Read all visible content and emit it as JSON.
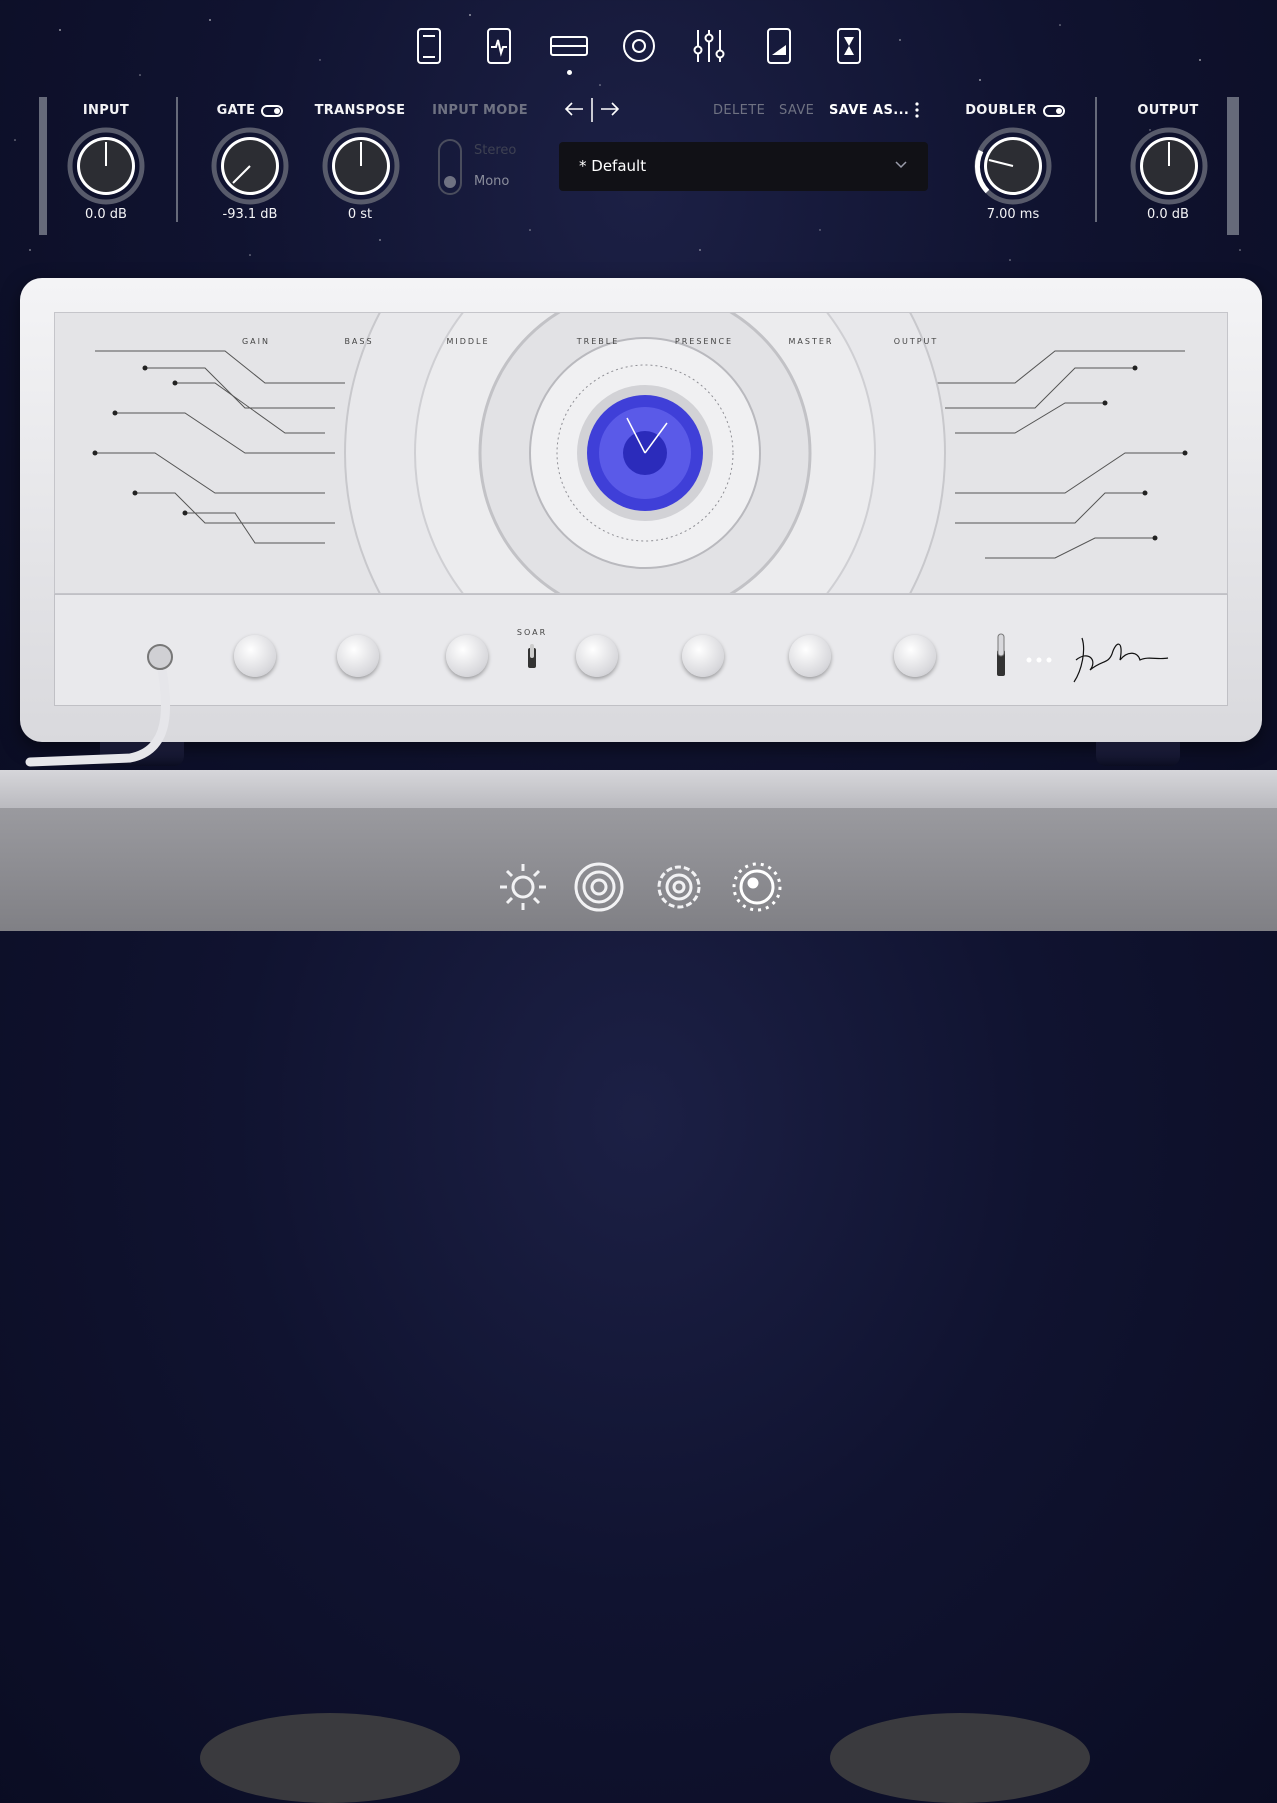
{
  "nav": {
    "items": [
      {
        "icon": "amp-head-icon",
        "active": false
      },
      {
        "icon": "pedal-icon",
        "active": false
      },
      {
        "icon": "amp-icon",
        "active": true
      },
      {
        "icon": "cabinet-icon",
        "active": false
      },
      {
        "icon": "mixer-sliders-icon",
        "active": false
      },
      {
        "icon": "volume-pedal-icon",
        "active": false
      },
      {
        "icon": "hourglass-icon",
        "active": false
      }
    ]
  },
  "header": {
    "input": {
      "label": "INPUT",
      "value": "0.0 dB"
    },
    "gate": {
      "label": "GATE",
      "value": "-93.1 dB",
      "enabled": true
    },
    "transpose": {
      "label": "TRANSPOSE",
      "value": "0 st"
    },
    "input_mode": {
      "label": "INPUT MODE",
      "options": [
        "Stereo",
        "Mono"
      ],
      "selected": "Mono"
    },
    "preset": {
      "delete": "DELETE",
      "save": "SAVE",
      "save_as": "SAVE AS...",
      "name": "* Default"
    },
    "doubler": {
      "label": "DOUBLER",
      "value": "7.00 ms",
      "enabled": true
    },
    "output": {
      "label": "OUTPUT",
      "value": "0.0 dB"
    }
  },
  "amp": {
    "controls": [
      "GAIN",
      "BASS",
      "MIDDLE",
      "TREBLE",
      "PRESENCE",
      "MASTER",
      "OUTPUT"
    ],
    "switch_label": "SOAR"
  },
  "bottom_bar": {
    "items": [
      {
        "icon": "sun-gear-icon"
      },
      {
        "icon": "spiral-icon"
      },
      {
        "icon": "cog-icon"
      },
      {
        "icon": "dial-icon"
      }
    ]
  },
  "colors": {
    "background": "#101330",
    "accent": "#3f3fd8",
    "amp_body": "#e4e4e7"
  }
}
